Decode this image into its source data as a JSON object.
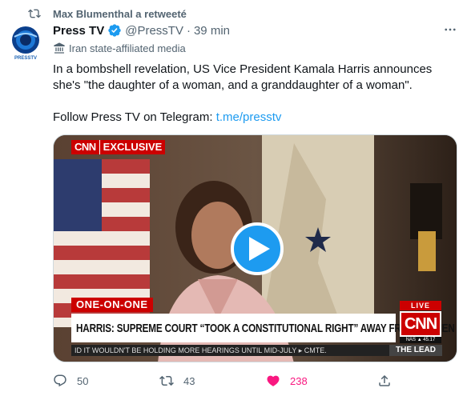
{
  "retweet_banner": {
    "text": "Max Blumenthal a retweeté",
    "icon": "retweet-icon"
  },
  "avatar": {
    "alt": "PRESSTV",
    "logo_text": "PRESSTV",
    "brand_color": "#1c64b5"
  },
  "author": {
    "name": "Press TV",
    "handle": "@PressTV",
    "separator": "·",
    "time": "39 min",
    "verified": true
  },
  "label": {
    "text": "Iran state-affiliated media",
    "icon": "government-building-icon"
  },
  "tweet": {
    "line1": "In a bombshell revelation, US Vice President Kamala Harris announces she's \"the daughter of a woman, and a granddaughter of a woman\".",
    "line2_prefix": "Follow Press TV on Telegram: ",
    "line2_link": "t.me/presstv"
  },
  "media": {
    "type": "video",
    "cnn_badge": "CNN",
    "exclusive_badge": "EXCLUSIVE",
    "segment_badge": "ONE-ON-ONE",
    "headline": "HARRIS: SUPREME COURT “TOOK A CONSTITUTIONAL RIGHT” AWAY FROM WOMEN",
    "live_label": "LIVE",
    "network_logo": "CNN",
    "live_clock": "NAS ▲ 45.17",
    "ticker": "ID IT WOULDN'T BE HOLDING MORE HEARINGS UNTIL MID-JULY  ▸  CMTE.",
    "show_name": "THE LEAD",
    "play_icon": "play-icon"
  },
  "actions": {
    "reply": {
      "count": "50",
      "icon": "reply-icon"
    },
    "retweet": {
      "count": "43",
      "icon": "retweet-icon"
    },
    "like": {
      "count": "238",
      "icon": "heart-filled-icon",
      "color": "#f91880"
    },
    "share": {
      "icon": "share-icon"
    }
  },
  "colors": {
    "accent": "#1d9bf0",
    "muted": "#536471",
    "cnn_red": "#cc0000"
  }
}
